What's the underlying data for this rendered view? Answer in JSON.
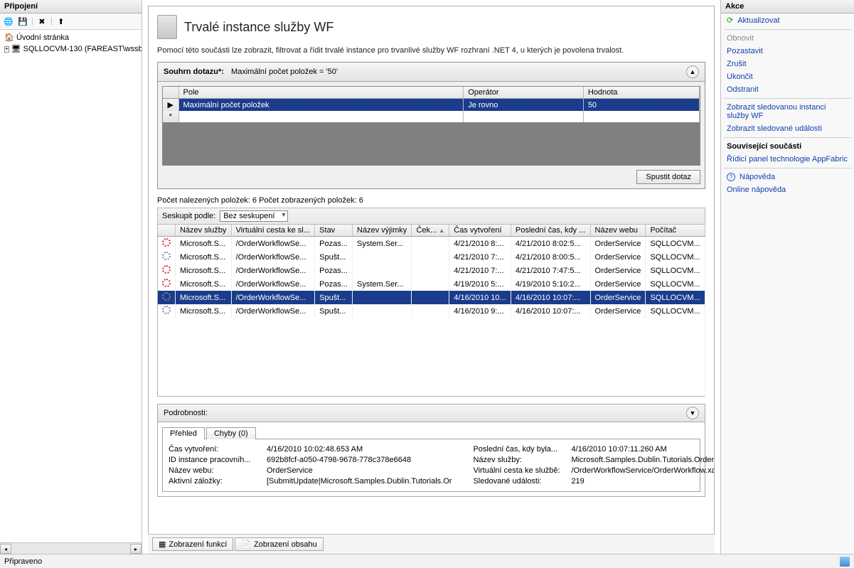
{
  "left": {
    "title": "Připojení",
    "tree": {
      "root": "Úvodní stránka",
      "server": "SQLLOCVM-130 (FAREAST\\wssb"
    }
  },
  "center": {
    "title": "Trvalé instance služby WF",
    "desc": "Pomocí této součásti lze zobrazit, filtrovat a řídit trvalé instance pro trvanlivé služby WF rozhraní .NET 4, u kterých je povolena trvalost.",
    "query": {
      "label": "Souhrn dotazu*:",
      "summary": "Maximální počet položek = '50'",
      "cols": {
        "field": "Pole",
        "op": "Operátor",
        "val": "Hodnota"
      },
      "row": {
        "field": "Maximální počet položek",
        "op": "Je rovno",
        "val": "50"
      },
      "run": "Spustit dotaz"
    },
    "count": "Počet nalezených položek: 6 Počet zobrazených položek: 6",
    "groupLabel": "Seskupit podle:",
    "groupValue": "Bez seskupení",
    "cols": {
      "name": "Název služby",
      "path": "Virtuální cesta ke sl...",
      "state": "Stav",
      "exc": "Název výjimky",
      "wait": "Ček...",
      "created": "Čas vytvoření",
      "last": "Poslední čas, kdy ...",
      "site": "Název webu",
      "host": "Počítač"
    },
    "rows": [
      {
        "name": "Microsoft.S...",
        "path": "/OrderWorkflowSe...",
        "state": "Pozas...",
        "exc": "System.Ser...",
        "created": "4/21/2010 8:...",
        "last": "4/21/2010 8:02:5...",
        "site": "OrderService",
        "host": "SQLLOCVM...",
        "sel": false,
        "red": true
      },
      {
        "name": "Microsoft.S...",
        "path": "/OrderWorkflowSe...",
        "state": "Spušt...",
        "exc": "",
        "created": "4/21/2010 7:...",
        "last": "4/21/2010 8:00:5...",
        "site": "OrderService",
        "host": "SQLLOCVM...",
        "sel": false,
        "red": false
      },
      {
        "name": "Microsoft.S...",
        "path": "/OrderWorkflowSe...",
        "state": "Pozas...",
        "exc": "",
        "created": "4/21/2010 7:...",
        "last": "4/21/2010 7:47:5...",
        "site": "OrderService",
        "host": "SQLLOCVM...",
        "sel": false,
        "red": true
      },
      {
        "name": "Microsoft.S...",
        "path": "/OrderWorkflowSe...",
        "state": "Pozas...",
        "exc": "System.Ser...",
        "created": "4/19/2010 5:...",
        "last": "4/19/2010 5:10:2...",
        "site": "OrderService",
        "host": "SQLLOCVM...",
        "sel": false,
        "red": true
      },
      {
        "name": "Microsoft.S...",
        "path": "/OrderWorkflowSe...",
        "state": "Spušt...",
        "exc": "",
        "created": "4/16/2010 10...",
        "last": "4/16/2010 10:07:...",
        "site": "OrderService",
        "host": "SQLLOCVM...",
        "sel": true,
        "red": false
      },
      {
        "name": "Microsoft.S...",
        "path": "/OrderWorkflowSe...",
        "state": "Spušt...",
        "exc": "",
        "created": "4/16/2010 9:...",
        "last": "4/16/2010 10:07:...",
        "site": "OrderService",
        "host": "SQLLOCVM...",
        "sel": false,
        "red": false
      }
    ],
    "details": {
      "head": "Podrobnosti:",
      "tab1": "Přehled",
      "tab2": "Chyby (0)",
      "left": {
        "k1": "Čas vytvoření:",
        "v1": "4/16/2010 10:02:48.653 AM",
        "k2": "ID instance pracovníh...",
        "v2": "692b8fcf-a050-4798-9678-778c378e6648",
        "k3": "Název webu:",
        "v3": "OrderService",
        "k4": "Aktivní záložky:",
        "v4": "[SubmitUpdate|Microsoft.Samples.Dublin.Tutorials.Or"
      },
      "right": {
        "k1": "Poslední čas, kdy byla...",
        "v1": "4/16/2010 10:07:11.260 AM",
        "k2": "Název služby:",
        "v2": "Microsoft.Samples.Dublin.Tutorials.OrderService.Orde",
        "k3": "Virtuální cesta ke službě:",
        "v3": "/OrderWorkflowService/OrderWorkflow.xamlx",
        "k4": "Sledované události:",
        "v4": "219"
      }
    },
    "footerTabs": {
      "t1": "Zobrazení funkcí",
      "t2": "Zobrazení obsahu"
    }
  },
  "right": {
    "title": "Akce",
    "items": {
      "refresh": "Aktualizovat",
      "resume": "Obnovit",
      "suspend": "Pozastavit",
      "cancel": "Zrušit",
      "terminate": "Ukončit",
      "delete": "Odstranit",
      "viewInst": "Zobrazit sledovanou instanci služby WF",
      "viewEv": "Zobrazit sledované události",
      "related": "Související součásti",
      "dash": "Řídicí panel technologie AppFabric",
      "help": "Nápověda",
      "online": "Online nápověda"
    }
  },
  "status": "Připraveno"
}
